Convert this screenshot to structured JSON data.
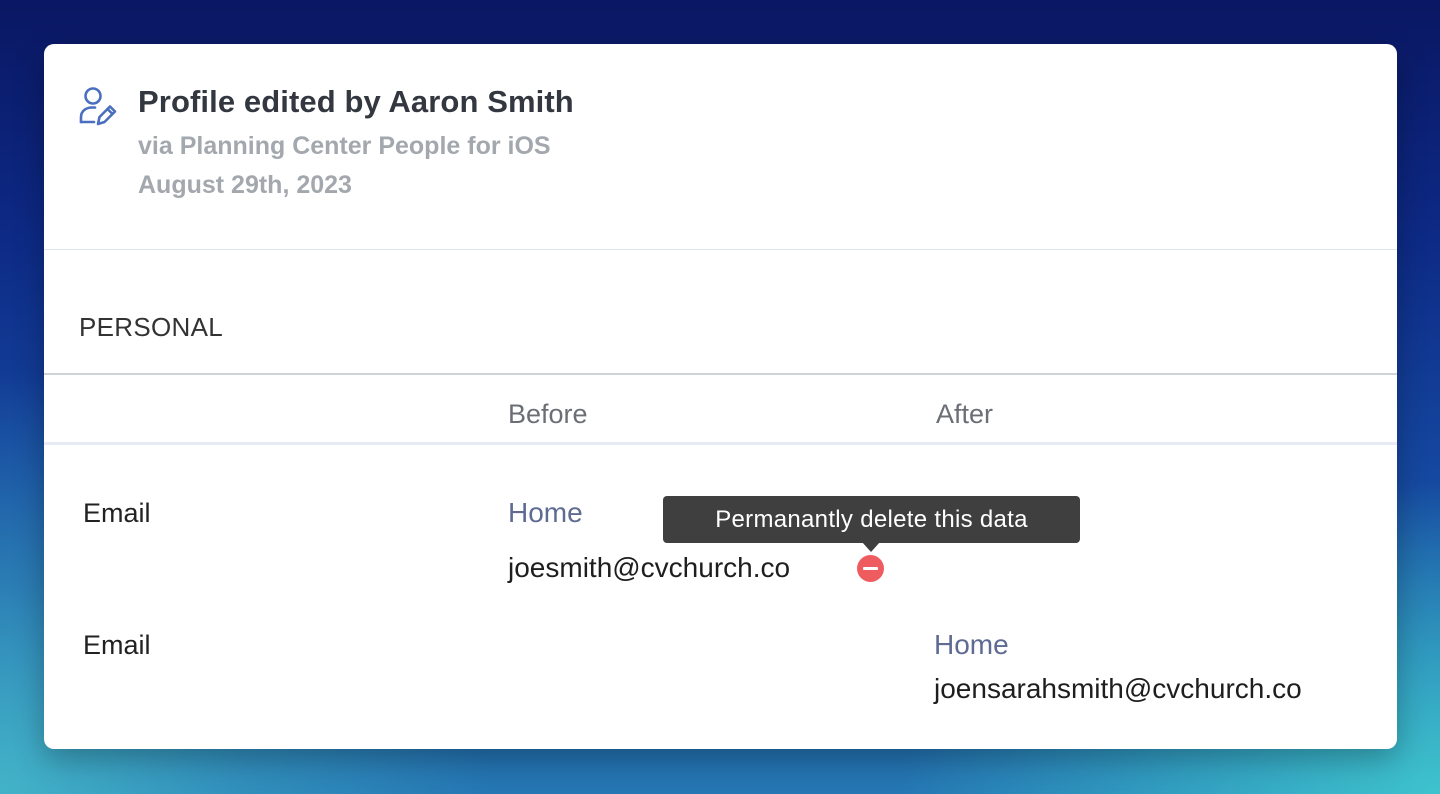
{
  "header": {
    "icon": "user-edit-icon",
    "title": "Profile edited by Aaron Smith",
    "via": "via Planning Center People for iOS",
    "date": "August 29th, 2023"
  },
  "section": {
    "label": "PERSONAL"
  },
  "columns": {
    "before": "Before",
    "after": "After"
  },
  "rows": [
    {
      "label": "Email",
      "before": {
        "kind": "Home",
        "value": "joesmith@cvchurch.co"
      },
      "after": null
    },
    {
      "label": "Email",
      "before": null,
      "after": {
        "kind": "Home",
        "value": "joensarahsmith@cvchurch.co"
      }
    }
  ],
  "tooltip": {
    "text": "Permanantly delete this data"
  },
  "colors": {
    "accent": "#4a6fc0",
    "kind_label": "#5f6b93",
    "delete": "#ef5c5f",
    "tooltip_bg": "#3f3f3f"
  }
}
